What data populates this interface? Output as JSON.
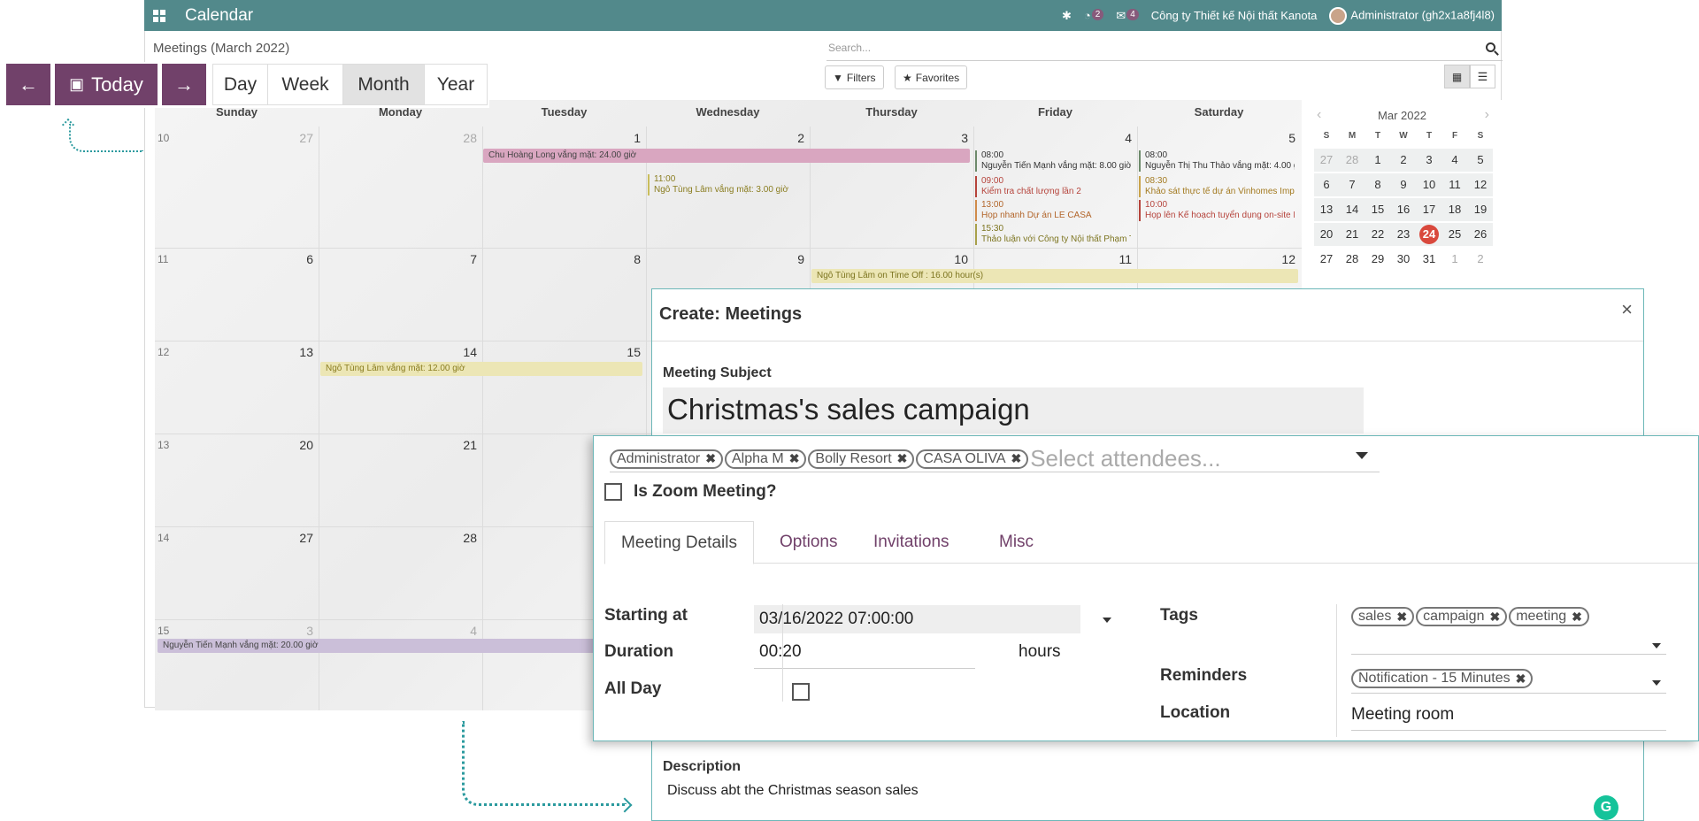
{
  "topbar": {
    "title": "Calendar",
    "activity_count": "2",
    "message_count": "4",
    "company": "Công ty Thiết kế Nội thất Kanota",
    "user": "Administrator (gh2x1a8fj4l8)"
  },
  "header": {
    "breadcrumb": "Meetings (March 2022)",
    "search_placeholder": "Search...",
    "filters_label": "Filters",
    "favorites_label": "Favorites"
  },
  "nav": {
    "today_label": "Today",
    "views": [
      "Day",
      "Week",
      "Month",
      "Year"
    ],
    "active_view": "Month"
  },
  "calendar": {
    "days": [
      "Sunday",
      "Monday",
      "Tuesday",
      "Wednesday",
      "Thursday",
      "Friday",
      "Saturday"
    ],
    "weeks": [
      {
        "num": "10",
        "dates": [
          "27",
          "28",
          "1",
          "2",
          "3",
          "4",
          "5"
        ]
      },
      {
        "num": "11",
        "dates": [
          "6",
          "7",
          "8",
          "9",
          "10",
          "11",
          "12"
        ]
      },
      {
        "num": "12",
        "dates": [
          "13",
          "14",
          "15",
          "",
          "",
          "",
          ""
        ]
      },
      {
        "num": "13",
        "dates": [
          "20",
          "21",
          "",
          "",
          "",
          "",
          ""
        ]
      },
      {
        "num": "14",
        "dates": [
          "27",
          "28",
          "",
          "",
          "",
          "",
          ""
        ]
      },
      {
        "num": "15",
        "dates": [
          "3",
          "4",
          "",
          "",
          "",
          "",
          ""
        ]
      }
    ],
    "events": {
      "e1": "Chu Hoàng Long vắng mặt: 24.00 giờ",
      "e2_time": "11:00",
      "e2": "Ngô Tùng Lâm vắng mặt: 3.00 giờ",
      "f1_time": "08:00",
      "f1": "Nguyễn Tiến Mạnh vắng mặt: 8.00 giờ",
      "f2_time": "09:00",
      "f2": "Kiểm tra chất lượng lần 2",
      "f3_time": "13:00",
      "f3": "Họp nhanh Dự án LE CASA",
      "f4_time": "15:30",
      "f4": "Thảo luận với Công ty Nội thất Phạm T",
      "s1_time": "08:00",
      "s1": "Nguyễn Thị Thu Thảo vắng mặt: 4.00 g",
      "s2_time": "08:30",
      "s2": "Khảo sát thực tế dự án Vinhomes Impe",
      "s3_time": "10:00",
      "s3": "Họp lên Kế hoạch tuyển dụng on-site E",
      "w2": "Ngô Tùng Lâm on Time Off : 16.00 hour(s)",
      "w3": "Ngô Tùng Lâm vắng mặt: 12.00 giờ",
      "w6": "Nguyễn Tiến Mạnh vắng mặt: 20.00 giờ"
    }
  },
  "mini": {
    "month": "Mar 2022",
    "heads": [
      "S",
      "M",
      "T",
      "W",
      "T",
      "F",
      "S"
    ],
    "rows": [
      [
        "27",
        "28",
        "1",
        "2",
        "3",
        "4",
        "5"
      ],
      [
        "6",
        "7",
        "8",
        "9",
        "10",
        "11",
        "12"
      ],
      [
        "13",
        "14",
        "15",
        "16",
        "17",
        "18",
        "19"
      ],
      [
        "20",
        "21",
        "22",
        "23",
        "24",
        "25",
        "26"
      ],
      [
        "27",
        "28",
        "29",
        "30",
        "31",
        "1",
        "2"
      ]
    ],
    "today": "24"
  },
  "dialog": {
    "title": "Create: Meetings",
    "subject_label": "Meeting Subject",
    "subject": "Christmas's sales campaign",
    "attendees": [
      "Administrator",
      "Alpha M",
      "Bolly Resort",
      "CASA OLIVA"
    ],
    "attendees_placeholder": "Select attendees...",
    "zoom_label": "Is Zoom Meeting?",
    "tabs": [
      "Meeting Details",
      "Options",
      "Invitations",
      "Misc"
    ],
    "starting_label": "Starting at",
    "starting": "03/16/2022 07:00:00",
    "duration_label": "Duration",
    "duration": "00:20",
    "hours_label": "hours",
    "allday_label": "All Day",
    "tags_label": "Tags",
    "tags": [
      "sales",
      "campaign",
      "meeting"
    ],
    "reminders_label": "Reminders",
    "reminder": "Notification - 15 Minutes",
    "location_label": "Location",
    "location": "Meeting room",
    "description_label": "Description",
    "description": "Discuss abt the Christmas season sales"
  },
  "colors": {
    "topbar": "#52898b",
    "primary": "#71416a",
    "today": "#d9493d",
    "accent": "#2b9a9e"
  }
}
